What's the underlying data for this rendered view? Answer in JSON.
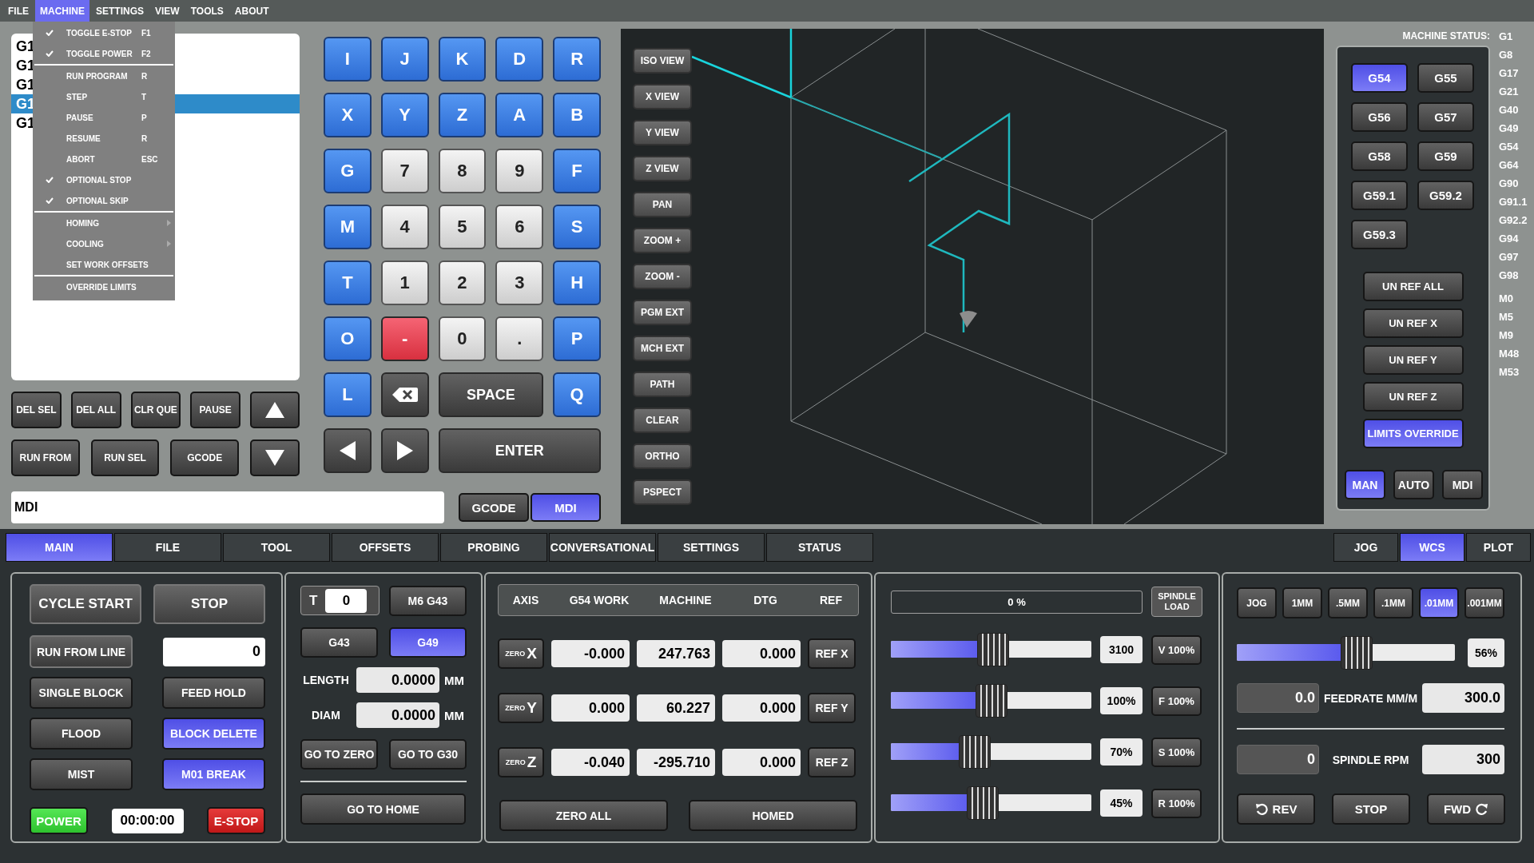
{
  "menu_bar": [
    {
      "label": "FILE",
      "selected": false
    },
    {
      "label": "MACHINE",
      "selected": true
    },
    {
      "label": "SETTINGS",
      "selected": false
    },
    {
      "label": "VIEW",
      "selected": false
    },
    {
      "label": "TOOLS",
      "selected": false
    },
    {
      "label": "ABOUT",
      "selected": false
    }
  ],
  "machine_menu": [
    [
      {
        "label": "TOGGLE E-STOP",
        "shortcut": "F1",
        "checked": true,
        "submenu": false
      },
      {
        "label": "TOGGLE POWER",
        "shortcut": "F2",
        "checked": true,
        "submenu": false
      }
    ],
    [
      {
        "label": "RUN PROGRAM",
        "shortcut": "R",
        "checked": false,
        "submenu": false
      },
      {
        "label": "STEP",
        "shortcut": "T",
        "checked": false,
        "submenu": false
      },
      {
        "label": "PAUSE",
        "shortcut": "P",
        "checked": false,
        "submenu": false
      },
      {
        "label": "RESUME",
        "shortcut": "R",
        "checked": false,
        "submenu": false
      },
      {
        "label": "ABORT",
        "shortcut": "ESC",
        "checked": false,
        "submenu": false
      },
      {
        "label": "OPTIONAL STOP",
        "checked": true,
        "submenu": false
      },
      {
        "label": "OPTIONAL SKIP",
        "checked": true,
        "submenu": false
      }
    ],
    [
      {
        "label": "HOMING",
        "checked": false,
        "submenu": true
      },
      {
        "label": "COOLING",
        "checked": false,
        "submenu": true
      },
      {
        "label": "SET WORK OFFSETS",
        "checked": false,
        "submenu": false
      }
    ],
    [
      {
        "label": "OVERRIDE LIMITS",
        "checked": false,
        "submenu": false
      }
    ]
  ],
  "gcode_list": [
    {
      "text": "G1",
      "selected": false
    },
    {
      "text": "G1",
      "selected": false
    },
    {
      "text": "G1",
      "selected": false
    },
    {
      "text": "G1",
      "selected": true
    },
    {
      "text": "G1",
      "selected": false
    }
  ],
  "list_buttons": [
    [
      {
        "kind": "text",
        "label": "DEL SEL"
      },
      {
        "kind": "text",
        "label": "DEL ALL"
      },
      {
        "kind": "text",
        "label": "CLR QUE"
      },
      {
        "kind": "text",
        "label": "PAUSE"
      },
      {
        "kind": "up"
      }
    ],
    [
      {
        "kind": "text",
        "label": "RUN FROM"
      },
      {
        "kind": "text",
        "label": "RUN SEL"
      },
      {
        "kind": "text",
        "label": "GCODE"
      },
      {
        "kind": "down"
      }
    ]
  ],
  "keypad": [
    [
      {
        "kind": "letter",
        "label": "I"
      },
      {
        "kind": "letter",
        "label": "J"
      },
      {
        "kind": "letter",
        "label": "K"
      },
      {
        "kind": "letter",
        "label": "D"
      },
      {
        "kind": "letter",
        "label": "R"
      }
    ],
    [
      {
        "kind": "letter",
        "label": "X"
      },
      {
        "kind": "letter",
        "label": "Y"
      },
      {
        "kind": "letter",
        "label": "Z"
      },
      {
        "kind": "letter",
        "label": "A"
      },
      {
        "kind": "letter",
        "label": "B"
      }
    ],
    [
      {
        "kind": "letter",
        "label": "G"
      },
      {
        "kind": "digit",
        "label": "7"
      },
      {
        "kind": "digit",
        "label": "8"
      },
      {
        "kind": "digit",
        "label": "9"
      },
      {
        "kind": "letter",
        "label": "F"
      }
    ],
    [
      {
        "kind": "letter",
        "label": "M"
      },
      {
        "kind": "digit",
        "label": "4"
      },
      {
        "kind": "digit",
        "label": "5"
      },
      {
        "kind": "digit",
        "label": "6"
      },
      {
        "kind": "letter",
        "label": "S"
      }
    ],
    [
      {
        "kind": "letter",
        "label": "T"
      },
      {
        "kind": "digit",
        "label": "1"
      },
      {
        "kind": "digit",
        "label": "2"
      },
      {
        "kind": "digit",
        "label": "3"
      },
      {
        "kind": "letter",
        "label": "H"
      }
    ],
    [
      {
        "kind": "letter",
        "label": "O"
      },
      {
        "kind": "minus",
        "label": "-"
      },
      {
        "kind": "digit",
        "label": "0"
      },
      {
        "kind": "digit",
        "label": "."
      },
      {
        "kind": "letter",
        "label": "P"
      }
    ],
    [
      {
        "kind": "letter",
        "label": "L"
      },
      {
        "kind": "backspace"
      },
      {
        "kind": "space",
        "label": "SPACE"
      },
      {
        "kind": "letter",
        "label": "Q"
      }
    ],
    [
      {
        "kind": "left"
      },
      {
        "kind": "right"
      },
      {
        "kind": "enter",
        "label": "ENTER"
      }
    ]
  ],
  "mdi_field": {
    "value": "MDI"
  },
  "mode_toggle": [
    {
      "label": "GCODE",
      "selected": false
    },
    {
      "label": "MDI",
      "selected": true
    }
  ],
  "view_buttons": [
    "ISO VIEW",
    "X VIEW",
    "Y VIEW",
    "Z VIEW",
    "PAN",
    "ZOOM +",
    "ZOOM -",
    "PGM EXT",
    "MCH EXT",
    "PATH",
    "CLEAR",
    "ORTHO",
    "PSPECT"
  ],
  "machine_status": {
    "label": "MACHINE STATUS:",
    "g_codes": [
      "G1",
      "G8",
      "G17",
      "G21",
      "G40",
      "G49",
      "G54",
      "G64",
      "G90",
      "G91.1",
      "G92.2",
      "G94",
      "G97",
      "G98"
    ],
    "m_codes": [
      "M0",
      "M5",
      "M9",
      "M48",
      "M53"
    ]
  },
  "wcs_buttons": [
    {
      "label": "G54",
      "selected": true
    },
    {
      "label": "G55",
      "selected": false
    },
    {
      "label": "G56",
      "selected": false
    },
    {
      "label": "G57",
      "selected": false
    },
    {
      "label": "G58",
      "selected": false
    },
    {
      "label": "G59",
      "selected": false
    },
    {
      "label": "G59.1",
      "selected": false
    },
    {
      "label": "G59.2",
      "selected": false
    },
    {
      "label": "G59.3",
      "selected": false
    }
  ],
  "ref_buttons": [
    {
      "label": "UN REF ALL",
      "selected": false
    },
    {
      "label": "UN REF X",
      "selected": false
    },
    {
      "label": "UN REF Y",
      "selected": false
    },
    {
      "label": "UN REF Z",
      "selected": false
    },
    {
      "label": "LIMITS OVERRIDE",
      "selected": true
    }
  ],
  "mode_buttons": [
    {
      "label": "MAN",
      "selected": true
    },
    {
      "label": "AUTO",
      "selected": false
    },
    {
      "label": "MDI",
      "selected": false
    }
  ],
  "main_tabs": [
    {
      "label": "MAIN",
      "selected": true
    },
    {
      "label": "FILE",
      "selected": false
    },
    {
      "label": "TOOL",
      "selected": false
    },
    {
      "label": "OFFSETS",
      "selected": false
    },
    {
      "label": "PROBING",
      "selected": false
    },
    {
      "label": "CONVERSATIONAL",
      "selected": false
    },
    {
      "label": "SETTINGS",
      "selected": false
    },
    {
      "label": "STATUS",
      "selected": false
    }
  ],
  "side_tabs": [
    {
      "label": "JOG",
      "selected": false
    },
    {
      "label": "WCS",
      "selected": true
    },
    {
      "label": "PLOT",
      "selected": false
    }
  ],
  "program_panel": {
    "cycle_start": "CYCLE START",
    "stop": "STOP",
    "run_from_line": {
      "label": "RUN FROM LINE",
      "value": "0"
    },
    "toggles": [
      {
        "label": "SINGLE BLOCK",
        "selected": false
      },
      {
        "label": "FEED HOLD",
        "selected": false
      },
      {
        "label": "FLOOD",
        "selected": false
      },
      {
        "label": "BLOCK DELETE",
        "selected": true
      },
      {
        "label": "MIST",
        "selected": false
      },
      {
        "label": "M01 BREAK",
        "selected": true
      }
    ],
    "power": {
      "label": "POWER",
      "on": true
    },
    "timer": "00:00:00",
    "estop": {
      "label": "E-STOP",
      "on": true
    }
  },
  "tool_panel": {
    "tool_label": "T",
    "tool_value": "0",
    "m6_button": "M6 G43",
    "offset_buttons": [
      {
        "label": "G43",
        "selected": false
      },
      {
        "label": "G49",
        "selected": true
      }
    ],
    "fields": [
      {
        "label": "LENGTH",
        "value": "0.0000",
        "unit": "MM"
      },
      {
        "label": "DIAM",
        "value": "0.0000",
        "unit": "MM"
      }
    ],
    "goto_buttons": [
      "GO TO ZERO",
      "GO TO G30"
    ],
    "home_button": "GO TO HOME"
  },
  "dro": {
    "columns": [
      "AXIS",
      "G54 WORK",
      "MACHINE",
      "DTG",
      "REF"
    ],
    "rows": [
      {
        "zero": "ZERO",
        "axis": "X",
        "work": "-0.000",
        "machine": "247.763",
        "dtg": "0.000",
        "ref": "REF X"
      },
      {
        "zero": "ZERO",
        "axis": "Y",
        "work": "0.000",
        "machine": "60.227",
        "dtg": "0.000",
        "ref": "REF Y"
      },
      {
        "zero": "ZERO",
        "axis": "Z",
        "work": "-0.040",
        "machine": "-295.710",
        "dtg": "0.000",
        "ref": "REF Z"
      }
    ],
    "buttons": [
      "ZERO ALL",
      "HOMED"
    ]
  },
  "overrides": {
    "spindle_load": {
      "reading": "0 %",
      "label": "SPINDLE LOAD",
      "level": 0
    },
    "sliders": [
      {
        "level": 0.51,
        "reading": "3100",
        "button": "V 100%"
      },
      {
        "level": 0.5,
        "reading": "100%",
        "button": "F 100%"
      },
      {
        "level": 0.42,
        "reading": "70%",
        "button": "S 100%"
      },
      {
        "level": 0.46,
        "reading": "45%",
        "button": "R 100%"
      }
    ]
  },
  "jog_panel": {
    "increments": [
      {
        "label": "JOG",
        "selected": false
      },
      {
        "label": "1MM",
        "selected": false
      },
      {
        "label": ".5MM",
        "selected": false
      },
      {
        "label": ".1MM",
        "selected": false
      },
      {
        "label": ".01MM",
        "selected": true
      },
      {
        "label": ".001MM",
        "selected": false
      }
    ],
    "slider": {
      "level": 0.55,
      "reading": "56%"
    },
    "feed": {
      "current": "0.0",
      "label": "FEEDRATE MM/M",
      "value": "300.0"
    },
    "spindle": {
      "current": "0",
      "label": "SPINDLE RPM",
      "value": "300"
    },
    "buttons": [
      {
        "kind": "rev",
        "label": "REV"
      },
      {
        "kind": "stop",
        "label": "STOP"
      },
      {
        "kind": "fwd",
        "label": "FWD"
      }
    ]
  }
}
